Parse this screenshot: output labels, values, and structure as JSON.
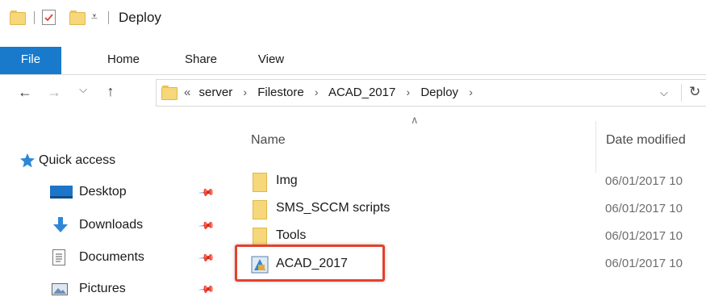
{
  "window": {
    "title": "Deploy"
  },
  "quick_access_toolbar": {
    "dropdown_glyph": "⩡"
  },
  "ribbon": {
    "tabs": [
      {
        "label": "File",
        "active": true
      },
      {
        "label": "Home"
      },
      {
        "label": "Share"
      },
      {
        "label": "View"
      }
    ]
  },
  "nav": {
    "back": "←",
    "forward": "→",
    "recent": "⌵",
    "up": "↑",
    "refresh": "↻",
    "dropdown": "⌵"
  },
  "address_bar": {
    "overflow": "«",
    "crumbs": [
      "server",
      "Filestore",
      "ACAD_2017",
      "Deploy"
    ],
    "separator": "›"
  },
  "columns": {
    "name": "Name",
    "date": "Date modified",
    "sort_glyph": "∧"
  },
  "nav_pane": {
    "quick_access": "Quick access",
    "items": [
      {
        "label": "Desktop",
        "icon": "desktop-icon"
      },
      {
        "label": "Downloads",
        "icon": "download-icon"
      },
      {
        "label": "Documents",
        "icon": "document-icon"
      },
      {
        "label": "Pictures",
        "icon": "pictures-icon"
      }
    ],
    "pin_glyph": "📌"
  },
  "files": [
    {
      "name": "Img",
      "date": "06/01/2017 10",
      "icon": "folder-icon"
    },
    {
      "name": "SMS_SCCM scripts",
      "date": "06/01/2017 10",
      "icon": "folder-icon"
    },
    {
      "name": "Tools",
      "date": "06/01/2017 10",
      "icon": "folder-icon"
    },
    {
      "name": "ACAD_2017",
      "date": "06/01/2017 10",
      "icon": "installer-icon"
    }
  ],
  "colors": {
    "accent": "#1979ca",
    "highlight": "#e3412c",
    "folder": "#f6d77a"
  }
}
